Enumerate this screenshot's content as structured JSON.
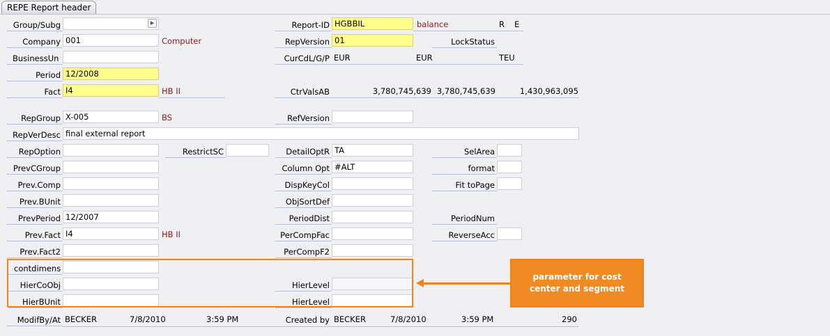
{
  "tab": {
    "label": "REPE Report header"
  },
  "left": {
    "group_subg": {
      "label": "Group/Subg",
      "value": ""
    },
    "company": {
      "label": "Company",
      "value": "001",
      "desc": "Computer"
    },
    "business_un": {
      "label": "BusinessUn",
      "value": ""
    },
    "period": {
      "label": "Period",
      "value": "12/2008"
    },
    "fact": {
      "label": "Fact",
      "value": "I4",
      "desc": "HB II"
    },
    "rep_group": {
      "label": "RepGroup",
      "value": "X-005",
      "desc": "BS"
    },
    "rep_ver_desc": {
      "label": "RepVerDesc",
      "value": "final external report"
    },
    "rep_option": {
      "label": "RepOption",
      "value": ""
    },
    "restrict_sc": {
      "label": "RestrictSC",
      "value": ""
    },
    "prev_cgroup": {
      "label": "PrevCGroup",
      "value": ""
    },
    "prev_comp": {
      "label": "Prev.Comp",
      "value": ""
    },
    "prev_bunit": {
      "label": "Prev.BUnit",
      "value": ""
    },
    "prev_period": {
      "label": "PrevPeriod",
      "value": "12/2007"
    },
    "prev_fact": {
      "label": "Prev.Fact",
      "value": "I4",
      "desc": "HB II"
    },
    "prev_fact2": {
      "label": "Prev.Fact2",
      "value": ""
    },
    "contdimens": {
      "label": "contdimens",
      "value": ""
    },
    "hier_co_obj": {
      "label": "HierCoObj",
      "value": ""
    },
    "hier_bunit": {
      "label": "HierBUnit",
      "value": ""
    }
  },
  "right": {
    "report_id": {
      "label": "Report-ID",
      "value": "HGBBIL",
      "desc": "balance",
      "flag1": "R",
      "flag2": "E"
    },
    "rep_version": {
      "label": "RepVersion",
      "value": "01",
      "lock_label": "LockStatus"
    },
    "cur_cd": {
      "label": "CurCdL/G/P",
      "v1": "EUR",
      "v2": "EUR",
      "v3": "TEU"
    },
    "ctr_vals": {
      "label": "CtrValsAB",
      "v1": "3,780,745,639",
      "v2": "3,780,745,639",
      "v3": "1,430,963,095"
    },
    "ref_version": {
      "label": "RefVersion",
      "value": ""
    },
    "detail_opt": {
      "label": "DetailOptR",
      "value": "TA"
    },
    "sel_area": {
      "label": "SelArea",
      "value": ""
    },
    "column_opt": {
      "label": "Column Opt",
      "value": "#ALT"
    },
    "format": {
      "label": "format",
      "value": ""
    },
    "disp_key_col": {
      "label": "DispKeyCol",
      "value": ""
    },
    "fit_to_page": {
      "label": "Fit toPage",
      "value": ""
    },
    "obj_sort_def": {
      "label": "ObjSortDef",
      "value": ""
    },
    "period_dist": {
      "label": "PeriodDist",
      "value": ""
    },
    "period_num": {
      "label": "PeriodNum"
    },
    "per_comp_fac": {
      "label": "PerCompFac",
      "value": ""
    },
    "reverse_acc": {
      "label": "ReverseAcc",
      "value": ""
    },
    "per_comp_f2": {
      "label": "PerCompF2",
      "value": ""
    },
    "hier_level1": {
      "label": "HierLevel",
      "value": ""
    },
    "hier_level2": {
      "label": "HierLevel",
      "value": ""
    }
  },
  "footer": {
    "modif_label": "ModifBy/At",
    "modif_by": "BECKER",
    "modif_date": "7/8/2010",
    "modif_time": "3:59 PM",
    "created_label": "Created by",
    "created_by": "BECKER",
    "created_date": "7/8/2010",
    "created_time": "3:59 PM",
    "count": "290"
  },
  "annotation": {
    "text": "parameter for cost center and segment",
    "color": "#f0841a"
  }
}
